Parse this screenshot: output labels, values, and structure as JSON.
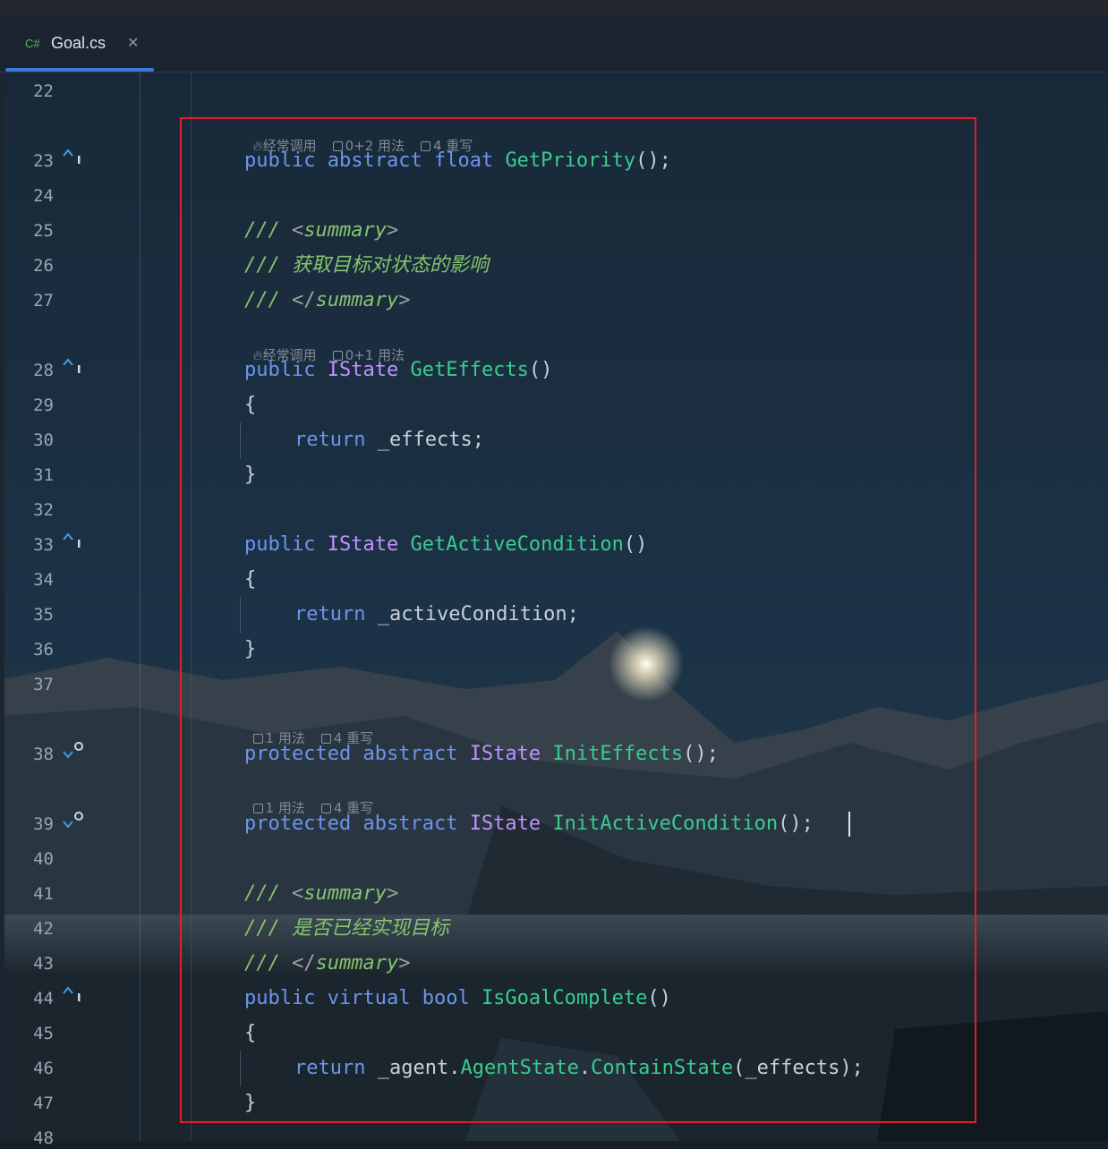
{
  "tab": {
    "lang": "C#",
    "title": "Goal.cs",
    "close": "✕"
  },
  "line_numbers": [
    "22",
    "23",
    "24",
    "25",
    "26",
    "27",
    "28",
    "29",
    "30",
    "31",
    "32",
    "33",
    "34",
    "35",
    "36",
    "37",
    "38",
    "39",
    "40",
    "41",
    "42",
    "43",
    "44",
    "45",
    "46",
    "47",
    "48"
  ],
  "gutter_icons": {
    "override": "implements-up-icon",
    "implemented": "implemented-down-icon"
  },
  "hints": {
    "h23": {
      "frequent": "经常调用",
      "usages": "0+2 用法",
      "overrides": "4 重写"
    },
    "h28": {
      "frequent": "经常调用",
      "usages": "0+1 用法"
    },
    "h38": {
      "usages": "1 用法",
      "overrides": "4 重写"
    },
    "h39": {
      "usages": "1 用法",
      "overrides": "4 重写"
    }
  },
  "code": {
    "l23": {
      "k1": "public",
      "k2": "abstract",
      "k3": "float",
      "fn": "GetPriority",
      "tail": "();"
    },
    "l25": {
      "slashes": "/// ",
      "open": "<",
      "tag": "summary",
      "close": ">"
    },
    "l26": {
      "text": "/// 获取目标对状态的影响"
    },
    "l27": {
      "slashes": "/// ",
      "open": "</",
      "tag": "summary",
      "close": ">"
    },
    "l28": {
      "k1": "public",
      "ty": "IState",
      "fn": "GetEffects",
      "tail": "()"
    },
    "l29": {
      "text": "{"
    },
    "l30": {
      "kw": "return",
      "rest": " _effects;"
    },
    "l31": {
      "text": "}"
    },
    "l33": {
      "k1": "public",
      "ty": "IState",
      "fn": "GetActiveCondition",
      "tail": "()"
    },
    "l34": {
      "text": "{"
    },
    "l35": {
      "kw": "return",
      "rest": " _activeCondition;"
    },
    "l36": {
      "text": "}"
    },
    "l38": {
      "k1": "protected",
      "k2": "abstract",
      "ty": "IState",
      "fn": "InitEffects",
      "tail": "();"
    },
    "l39": {
      "k1": "protected",
      "k2": "abstract",
      "ty": "IState",
      "fn": "InitActiveCondition",
      "tail": "();"
    },
    "l41": {
      "slashes": "/// ",
      "open": "<",
      "tag": "summary",
      "close": ">"
    },
    "l42": {
      "text": "/// 是否已经实现目标"
    },
    "l43": {
      "slashes": "/// ",
      "open": "</",
      "tag": "summary",
      "close": ">"
    },
    "l44": {
      "k1": "public",
      "k2": "virtual",
      "k3": "bool",
      "fn": "IsGoalComplete",
      "tail": "()"
    },
    "l45": {
      "text": "{"
    },
    "l46": {
      "kw": "return",
      "p1": " _agent.",
      "ty": "AgentState",
      "dot": ".",
      "fn": "ContainState",
      "tail": "(_effects);"
    },
    "l47": {
      "text": "}"
    }
  }
}
